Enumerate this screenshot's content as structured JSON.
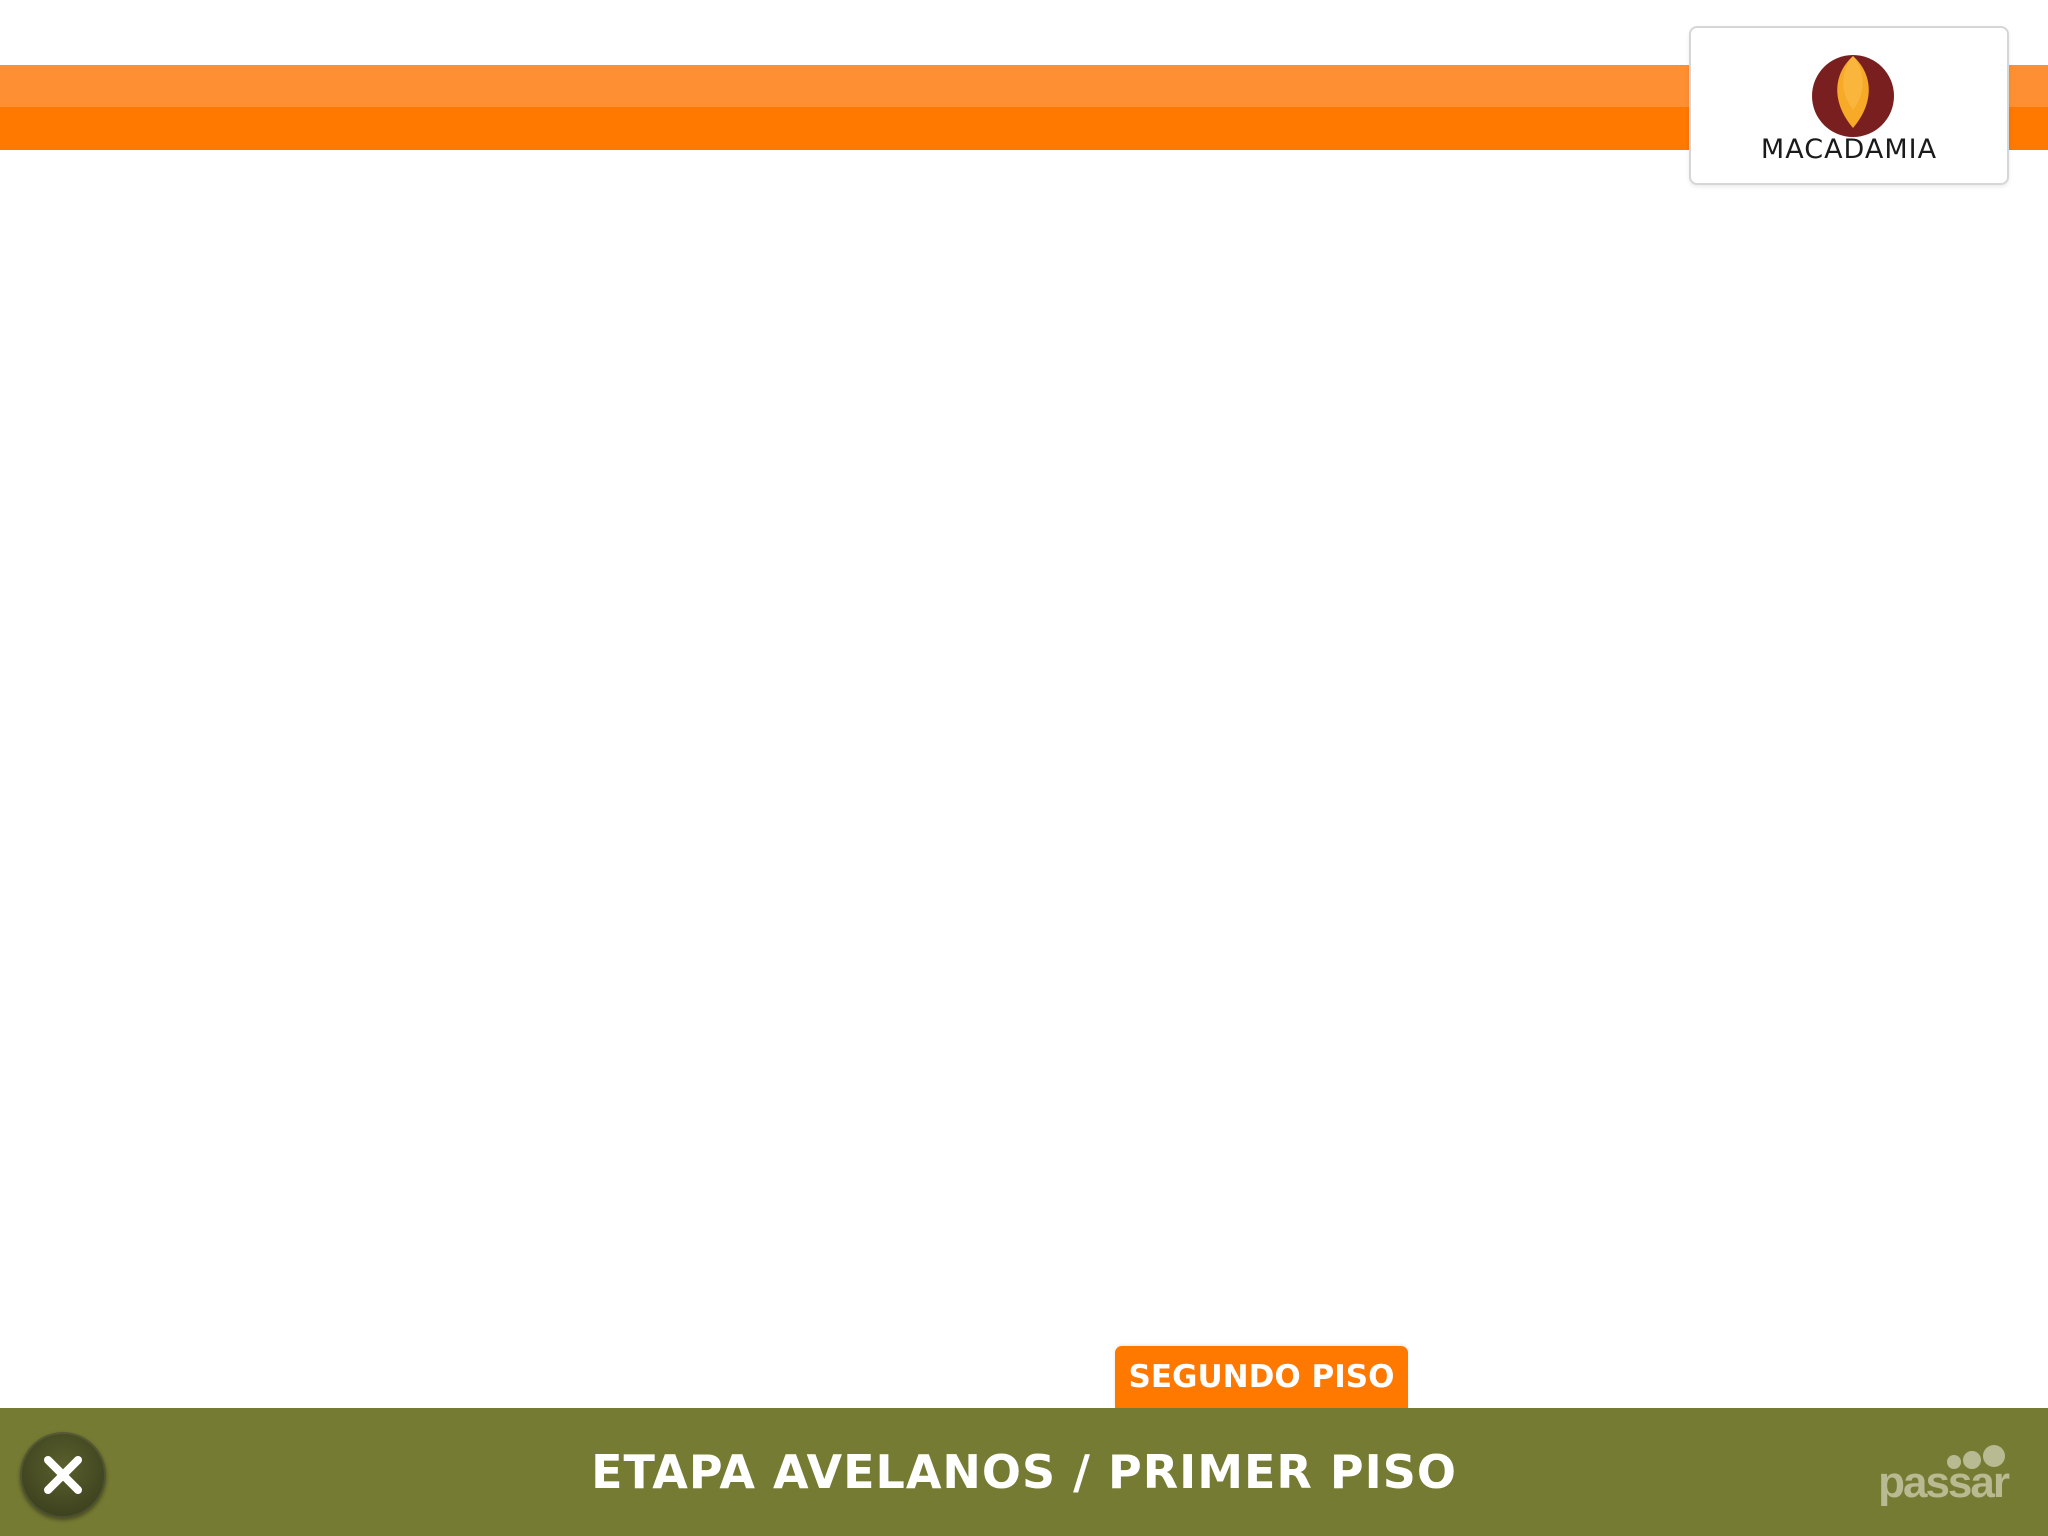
{
  "header": {
    "logo_text": "MACADAMIA",
    "logo_icon": "macadamia-nut-logo",
    "colors": {
      "stripe_light": "#ff8f33",
      "stripe_dark": "#ff7800",
      "logo_outer": "#7a1f1f",
      "logo_inner": "#f7a928"
    }
  },
  "floor_tab": {
    "label": "SEGUNDO PISO",
    "color": "#ff7800"
  },
  "footer": {
    "title": "ETAPA AVELANOS / PRIMER PISO",
    "close_icon": "close-icon",
    "brand": "passar",
    "background": "#767b33"
  }
}
